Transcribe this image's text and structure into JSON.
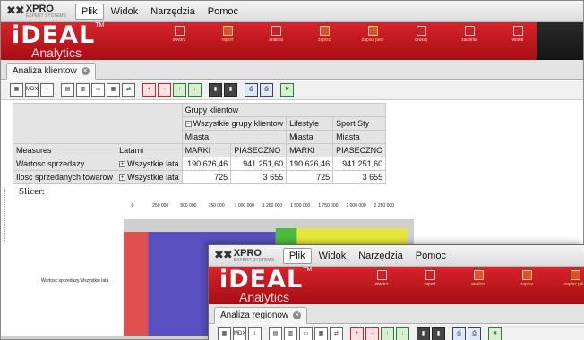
{
  "main_window": {
    "menubar": {
      "logo": "XPRO",
      "logo_sub": "EXPERT SYSTEMS",
      "items": [
        "Plik",
        "Widok",
        "Narzędzia",
        "Pomoc"
      ]
    },
    "banner": {
      "brand": "iDEAL",
      "tm": "TM",
      "sub": "Analytics",
      "buttons": [
        "otwórz",
        "raport",
        "analiza",
        "zapisz",
        "zapisz jako",
        "drukuj",
        "zadania",
        "widok"
      ],
      "highlighted": [
        1,
        3,
        4
      ]
    },
    "tab": {
      "label": "Analiza klientow"
    },
    "toolbar_icons": [
      "pivot-icon",
      "mdx-icon",
      "sort-icon",
      "table-icon",
      "column-icon",
      "row-icon",
      "grid-icon",
      "swap-icon",
      "add-icon",
      "remove-icon",
      "drill-up-icon",
      "drill-down-icon",
      "chart-icon",
      "chart-options-icon",
      "print-icon",
      "print-preview-icon",
      "excel-export-icon"
    ],
    "pivot": {
      "col_header_group": "Grupy klientow",
      "col_groups": [
        "Wszystkie grupy klientow",
        "Lifestyle",
        "Sport Sty"
      ],
      "col_level": "Miasta",
      "col_members": [
        "MARKI",
        "PIASECZNO",
        "MARKI",
        "PIASECZNO"
      ],
      "measures_label": "Measures",
      "row_level": "Latami",
      "rows": [
        {
          "measure": "Wartosc sprzedazy",
          "year": "Wszystkie lata",
          "values": [
            "190 626,46",
            "941 251,60",
            "190 626,46",
            "941 251,60"
          ]
        },
        {
          "measure": "Ilosc sprzedanych towarow",
          "year": "Wszystkie lata",
          "values": [
            "725",
            "3 655",
            "725",
            "3 655"
          ]
        }
      ]
    },
    "slicer_label": "Slicer:"
  },
  "chart_data": {
    "type": "bar",
    "orientation": "horizontal",
    "stacked": true,
    "categories": [
      "Wartosc sprzedazy.Wszystkie lata"
    ],
    "series": [
      {
        "values": [
          140000
        ],
        "color": "#e05050"
      },
      {
        "values": [
          1140000
        ],
        "color": "#5a4fc0"
      },
      {
        "values": [
          190000
        ],
        "color": "#4cba3a"
      },
      {
        "values": [
          990000
        ],
        "color": "#e6e63a"
      }
    ],
    "xticks": [
      "0",
      "250 000",
      "500 000",
      "750 000",
      "1 000 000",
      "1 250 000",
      "1 500 000",
      "1 750 000",
      "2 000 000",
      "2 250 000"
    ],
    "xlim": [
      0,
      2500000
    ],
    "legend": "none"
  },
  "second_window": {
    "menubar": {
      "logo": "XPRO",
      "logo_sub": "EXPERT SYSTEMS",
      "items": [
        "Plik",
        "Widok",
        "Narzędzia",
        "Pomoc"
      ]
    },
    "banner": {
      "brand": "iDEAL",
      "tm": "TM",
      "sub": "Analytics",
      "buttons": [
        "otwórz",
        "raport",
        "analiza",
        "zapisz",
        "zapisz jako"
      ],
      "highlighted": [
        2,
        3,
        4
      ]
    },
    "tab": {
      "label": "Analiza regionow"
    }
  },
  "colors": {
    "banner_red": "#c0161e",
    "dark": "#1c1c1c",
    "highlight": "#f7d27a"
  }
}
